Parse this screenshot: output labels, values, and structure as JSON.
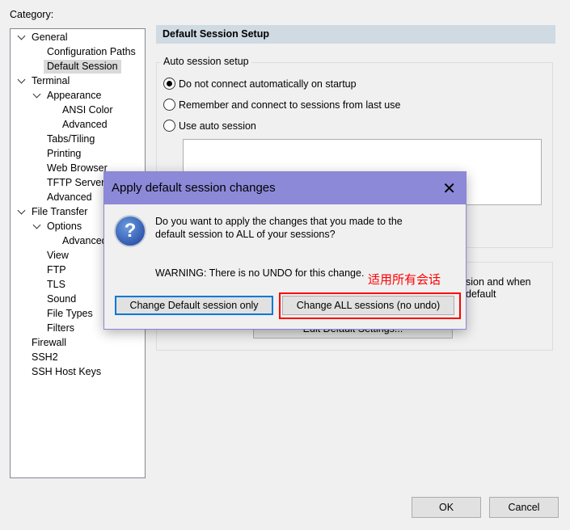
{
  "category_label": "Category:",
  "tree": [
    {
      "label": "General",
      "level": 0,
      "expanded": true
    },
    {
      "label": "Configuration Paths",
      "level": 1
    },
    {
      "label": "Default Session",
      "level": 1,
      "selected": true
    },
    {
      "label": "Terminal",
      "level": 0,
      "expanded": true
    },
    {
      "label": "Appearance",
      "level": 1,
      "expanded": true
    },
    {
      "label": "ANSI Color",
      "level": 2
    },
    {
      "label": "Advanced",
      "level": 2
    },
    {
      "label": "Tabs/Tiling",
      "level": 1
    },
    {
      "label": "Printing",
      "level": 1
    },
    {
      "label": "Web Browser",
      "level": 1
    },
    {
      "label": "TFTP Server",
      "level": 1
    },
    {
      "label": "Advanced",
      "level": 1
    },
    {
      "label": "File Transfer",
      "level": 0,
      "expanded": true
    },
    {
      "label": "Options",
      "level": 1,
      "expanded": true
    },
    {
      "label": "Advanced",
      "level": 2
    },
    {
      "label": "View",
      "level": 1
    },
    {
      "label": "FTP",
      "level": 1
    },
    {
      "label": "TLS",
      "level": 1
    },
    {
      "label": "Sound",
      "level": 1
    },
    {
      "label": "File Types",
      "level": 1
    },
    {
      "label": "Filters",
      "level": 1
    },
    {
      "label": "Firewall",
      "level": 0
    },
    {
      "label": "SSH2",
      "level": 0
    },
    {
      "label": "SSH Host Keys",
      "level": 0
    }
  ],
  "panel": {
    "title": "Default Session Setup",
    "group1": "Auto session setup",
    "radios": [
      {
        "label": "Do not connect automatically on startup",
        "checked": true
      },
      {
        "label": "Remember and connect to sessions from last use",
        "checked": false
      },
      {
        "label": "Use auto session",
        "checked": false
      }
    ],
    "group2_line1": "sion and when",
    "group2_line2": "default",
    "edit_button": "Edit Default Settings..."
  },
  "dialog": {
    "title": "Apply default session changes",
    "icon": "question-icon",
    "message1": "Do you want to apply the changes that you made to the",
    "message2": "default session to ALL of your sessions?",
    "warning": "WARNING: There is no UNDO for this change.",
    "annotation": "适用所有会话",
    "button_default": "Change Default session only",
    "button_all": "Change ALL sessions (no undo)",
    "annotation_color": "#ff0000",
    "focus_color": "#0078d7"
  },
  "footer": {
    "ok": "OK",
    "cancel": "Cancel"
  }
}
